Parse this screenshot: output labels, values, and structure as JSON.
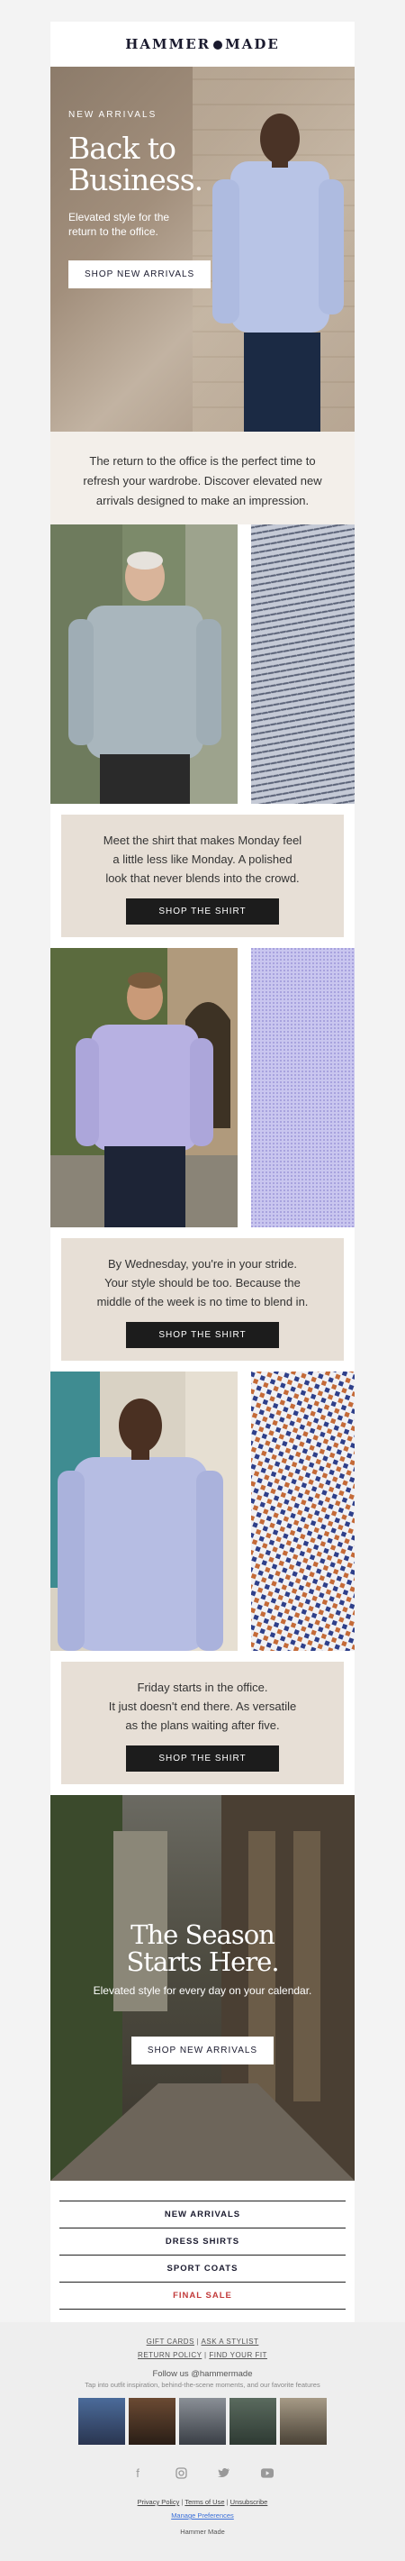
{
  "header": {
    "logo_left": "HAMMER",
    "logo_right": "MADE"
  },
  "hero": {
    "kicker": "NEW ARRIVALS",
    "headline_1": "Back to",
    "headline_2": "Business.",
    "sub_1": "Elevated style for the",
    "sub_2": "return to the office.",
    "cta": "SHOP NEW ARRIVALS"
  },
  "intro": {
    "line_1": "The return to the office is the perfect time to",
    "line_2": "refresh your wardrobe. Discover elevated new",
    "line_3": "arrivals designed to make an impression."
  },
  "shirts": [
    {
      "line_1": "Meet the shirt that makes Monday feel",
      "line_2": "a little less like Monday. A polished",
      "line_3": "look that never blends into the crowd.",
      "cta": "SHOP THE SHIRT"
    },
    {
      "line_1": "By Wednesday, you're in your stride.",
      "line_2": "Your style should be too. Because the",
      "line_3": "middle of the week is no time to blend in.",
      "cta": "SHOP THE SHIRT"
    },
    {
      "line_1": "Friday starts in the office.",
      "line_2": "It just doesn't end there. As versatile",
      "line_3": "as the plans waiting after five.",
      "cta": "SHOP THE SHIRT"
    }
  ],
  "season": {
    "headline_1": "The Season",
    "headline_2": "Starts Here.",
    "sub": "Elevated style for every day on your calendar.",
    "cta": "SHOP NEW ARRIVALS"
  },
  "nav": [
    "NEW ARRIVALS",
    "DRESS SHIRTS",
    "SPORT COATS",
    "FINAL SALE"
  ],
  "footer": {
    "link_gift": "GIFT CARDS",
    "link_stylist": "ASK A STYLIST",
    "link_return": "RETURN POLICY",
    "link_fit": "FIND YOUR FIT",
    "sep": "|",
    "follow": "Follow us @hammermade",
    "tagline": "Tap into outfit inspiration, behind-the-scene moments, and our favorite features",
    "privacy": "Privacy Policy",
    "terms": "Terms of Use",
    "unsubscribe": "Unsubscribe",
    "preferences": "Manage Preferences",
    "brand": "Hammer Made"
  },
  "social_icons": [
    "facebook-icon",
    "instagram-icon",
    "twitter-icon",
    "youtube-icon"
  ],
  "colors": {
    "accent": "#1a1a2e",
    "sale": "#c23b3b",
    "panel": "#e7dfd6",
    "intro": "#f3efea"
  }
}
